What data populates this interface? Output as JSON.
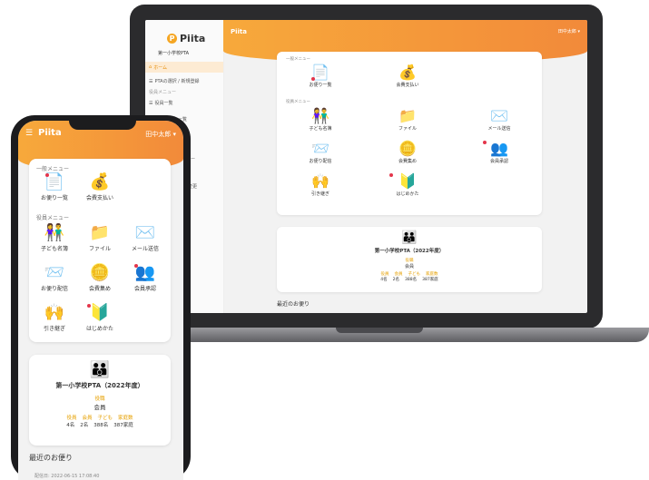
{
  "laptop": {
    "brand": "Piita",
    "school": "第一小学校PTA",
    "header_title": "Piita",
    "user": "田中太郎",
    "sidebar": {
      "items": [
        {
          "label": "ホーム"
        },
        {
          "label": "PTAの選択 / 新規登録"
        },
        {
          "label": "役員メニュー"
        },
        {
          "label": "役員一覧"
        },
        {
          "label": "ー覧"
        },
        {
          "label": "ニュー"
        },
        {
          "label": "報"
        },
        {
          "label": "の変更"
        }
      ]
    },
    "menu": {
      "general_label": "一般メニュー",
      "officer_label": "役員メニュー",
      "general_items": [
        {
          "label": "お便り一覧",
          "icon": "📄"
        },
        {
          "label": "会費支払い",
          "icon": "💰"
        }
      ],
      "officer_items": [
        {
          "label": "子ども名簿",
          "icon": "👫"
        },
        {
          "label": "ファイル",
          "icon": "📁"
        },
        {
          "label": "メール送信",
          "icon": "✉️"
        },
        {
          "label": "お便り配信",
          "icon": "📨"
        },
        {
          "label": "会費集め",
          "icon": "🪙"
        },
        {
          "label": "会員承認",
          "icon": "👥"
        },
        {
          "label": "引き継ぎ",
          "icon": "🙌"
        },
        {
          "label": "はじめかた",
          "icon": "🔰"
        }
      ]
    },
    "org": {
      "icon": "👪",
      "title": "第一小学校PTA（2022年度）",
      "role_label": "役職",
      "role": "会員",
      "stat_labels": [
        "役員",
        "会員",
        "子ども",
        "家庭数"
      ],
      "stat_values": [
        "4名",
        "2名",
        "388名",
        "387家庭"
      ]
    },
    "recent_title": "最近のお便り"
  },
  "phone": {
    "brand": "Piita",
    "menu_icon": "☰",
    "user": "田中太郎",
    "menu": {
      "general_label": "一般メニュー",
      "officer_label": "役員メニュー",
      "general_items": [
        {
          "label": "お便り一覧",
          "icon": "📄"
        },
        {
          "label": "会費支払い",
          "icon": "💰"
        }
      ],
      "officer_items": [
        {
          "label": "子ども名簿",
          "icon": "👫"
        },
        {
          "label": "ファイル",
          "icon": "📁"
        },
        {
          "label": "メール送信",
          "icon": "✉️"
        },
        {
          "label": "お便り配信",
          "icon": "📨"
        },
        {
          "label": "会費集め",
          "icon": "🪙"
        },
        {
          "label": "会員承認",
          "icon": "👥"
        },
        {
          "label": "引き継ぎ",
          "icon": "🙌"
        },
        {
          "label": "はじめかた",
          "icon": "🔰"
        }
      ]
    },
    "org": {
      "icon": "👪",
      "title": "第一小学校PTA（2022年度）",
      "role_label": "役職",
      "role": "会員",
      "stat_labels": [
        "役員",
        "会員",
        "子ども",
        "家庭数"
      ],
      "stat_values": [
        "4名",
        "2名",
        "388名",
        "387家庭"
      ]
    },
    "recent_title": "最近のお便り",
    "recent_date": "配信日: 2022-06-15 17:08:40"
  },
  "colors": {
    "header_start": "#f7a93b",
    "header_end": "#f28a3a",
    "stat_label": "#e6a000",
    "badge": "#e4354b"
  }
}
